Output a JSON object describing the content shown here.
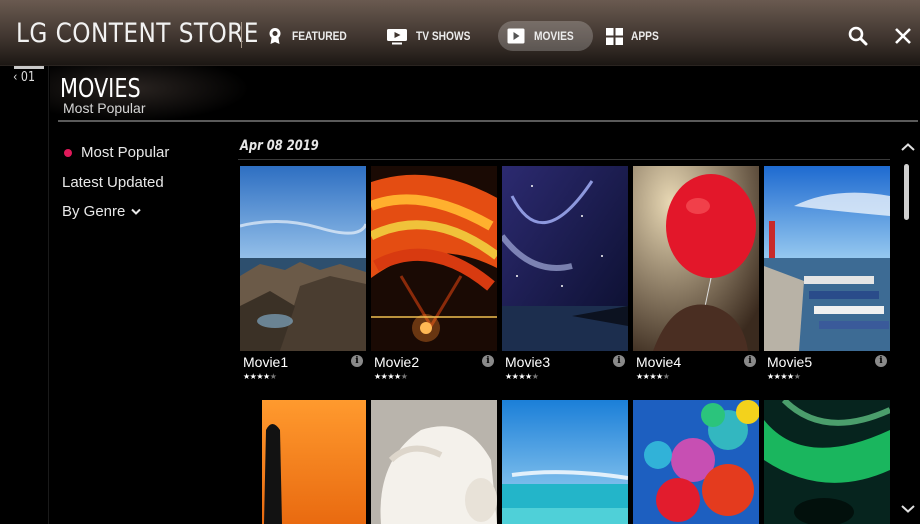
{
  "header": {
    "brand": "LG CONTENT STORE",
    "nav": [
      {
        "label": "FEATURED",
        "icon": "featured-badge-icon",
        "active": false
      },
      {
        "label": "TV SHOWS",
        "icon": "tv-play-icon",
        "active": false
      },
      {
        "label": "MOVIES",
        "icon": "movie-play-icon",
        "active": true
      },
      {
        "label": "APPS",
        "icon": "apps-grid-icon",
        "active": false
      }
    ],
    "search_icon": "search-icon",
    "close_icon": "close-icon"
  },
  "rail": {
    "back_label": "‹ 01"
  },
  "page": {
    "title": "MOVIES",
    "subtitle": "Most Popular"
  },
  "sidebar": {
    "items": [
      {
        "label": "Most Popular",
        "selected": true
      },
      {
        "label": "Latest Updated",
        "selected": false
      },
      {
        "label": "By Genre",
        "selected": false,
        "has_dropdown": true
      }
    ],
    "accent_color": "#e0195a"
  },
  "content": {
    "date": "Apr 08 2019",
    "movies": [
      {
        "name": "Movie1",
        "rating": 4,
        "max_rating": 5,
        "scene": "rocky coastline"
      },
      {
        "name": "Movie2",
        "rating": 4,
        "max_rating": 5,
        "scene": "hot air balloon"
      },
      {
        "name": "Movie3",
        "rating": 4,
        "max_rating": 5,
        "scene": "night sky"
      },
      {
        "name": "Movie4",
        "rating": 4,
        "max_rating": 5,
        "scene": "red balloon"
      },
      {
        "name": "Movie5",
        "rating": 4,
        "max_rating": 5,
        "scene": "harbor"
      }
    ],
    "second_row": [
      "sunset cactus",
      "puppy",
      "beach",
      "colorful balloons",
      "aurora"
    ]
  }
}
